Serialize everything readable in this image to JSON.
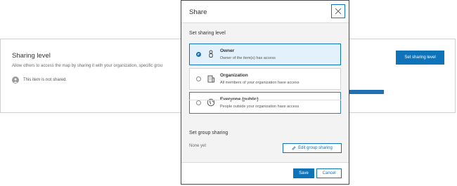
{
  "background": {
    "title": "Sharing level",
    "description": "Allow others to access the map by sharing it with your organization, specific grou",
    "status": "This item is not shared.",
    "set_level_button": "Set sharing level"
  },
  "modal": {
    "title": "Share",
    "sharing_level_label": "Set sharing level",
    "options": [
      {
        "title": "Owner",
        "desc": "Owner of the item(s) has access",
        "icon": "person-icon",
        "selected": true
      },
      {
        "title": "Organization",
        "desc": "All members of your organization have access",
        "icon": "building-icon",
        "selected": false
      },
      {
        "title": "Everyone (public)",
        "desc": "People outside your organization have access",
        "icon": "globe-icon",
        "selected": false
      }
    ],
    "group_label": "Set group sharing",
    "group_value": "None yet",
    "edit_group_button": "Edit group sharing",
    "save_button": "Save",
    "cancel_button": "Cancel"
  },
  "colors": {
    "accent": "#0f73b9",
    "selected_bg": "#e2f1fb",
    "arrow": "#1f6fb5"
  }
}
